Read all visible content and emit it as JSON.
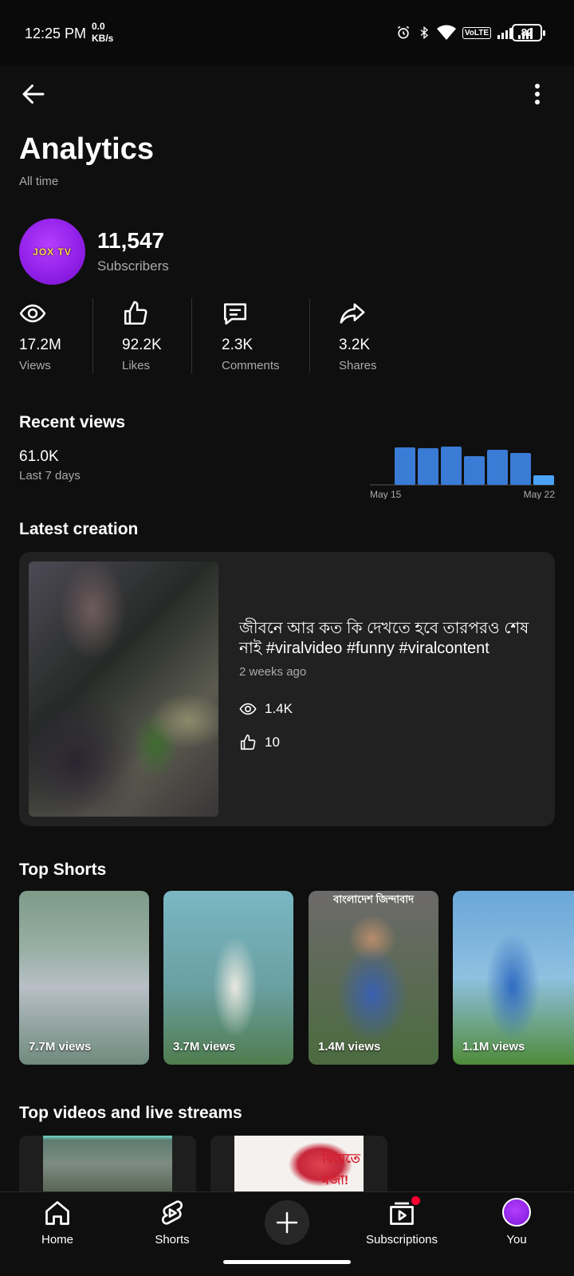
{
  "status_bar": {
    "time": "12:25 PM",
    "net_speed_value": "0.0",
    "net_speed_unit": "KB/s",
    "network_type": "VoLTE",
    "battery": "82"
  },
  "header": {
    "title": "Analytics",
    "subtitle": "All time"
  },
  "channel": {
    "avatar_text": "JOX",
    "avatar_text_2": "TV",
    "subscribers": "11,547",
    "subscribers_label": "Subscribers"
  },
  "stats": [
    {
      "value": "17.2M",
      "label": "Views"
    },
    {
      "value": "92.2K",
      "label": "Likes"
    },
    {
      "value": "2.3K",
      "label": "Comments"
    },
    {
      "value": "3.2K",
      "label": "Shares"
    }
  ],
  "recent_views": {
    "title": "Recent views",
    "value": "61.0K",
    "period": "Last 7 days"
  },
  "chart_data": {
    "type": "bar",
    "categories": [
      "May 15",
      "May 16",
      "May 17",
      "May 18",
      "May 19",
      "May 20",
      "May 21",
      "May 22"
    ],
    "values": [
      0,
      9.4,
      9.2,
      9.6,
      7.2,
      8.8,
      8.0,
      2.4
    ],
    "x_tick_labels": [
      "May 15",
      "May 22"
    ],
    "colors": {
      "bars": "#3a7bd5",
      "last_bar": "#4aa3f7",
      "baseline": "#555555"
    }
  },
  "latest_creation": {
    "title": "Latest creation",
    "video_title": "জীবনে আর কত কি দেখতে হবে তারপরও শেষ নাই #viralvideo #funny #viralcontent",
    "age": "2 weeks ago",
    "views": "1.4K",
    "likes": "10"
  },
  "top_shorts": {
    "title": "Top Shorts",
    "items": [
      {
        "views": "7.7M views"
      },
      {
        "views": "3.7M views"
      },
      {
        "views": "1.4M views",
        "banner": "বাংলাদেশ জিন্দাবাদ"
      },
      {
        "views": "1.1M views"
      }
    ]
  },
  "top_videos": {
    "title": "Top videos and live streams",
    "thumb_text": "বিয়েতে মজা!"
  },
  "nav": {
    "home": "Home",
    "shorts": "Shorts",
    "subscriptions": "Subscriptions",
    "you": "You"
  },
  "icons": {
    "back": "arrow-left-icon",
    "more": "more-vertical-icon",
    "views": "eye-icon",
    "likes": "thumbs-up-icon",
    "comments": "comment-icon",
    "shares": "share-icon"
  },
  "colors": {
    "background": "#0f0f0f",
    "card": "#212121",
    "accent_red": "#ff0033"
  }
}
